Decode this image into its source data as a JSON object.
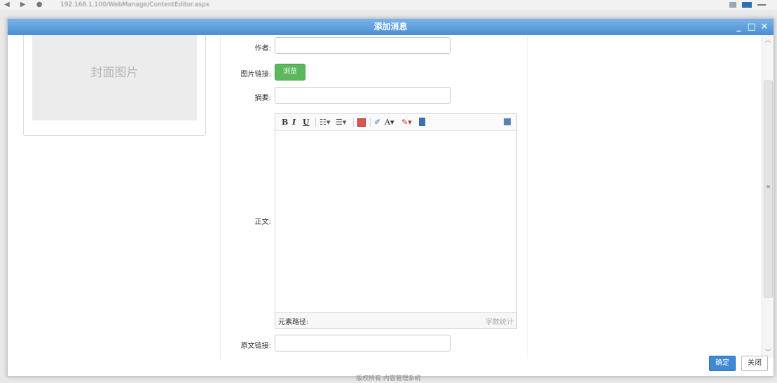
{
  "browser": {
    "url": "192.168.1.100/WebManage/ContentEditor.aspx"
  },
  "dialog": {
    "title": "添加消息",
    "controls": {
      "minimize": "_",
      "maximize": "□",
      "close": "✕"
    }
  },
  "cover": {
    "placeholder": "封面图片"
  },
  "form": {
    "author_label": "作者:",
    "image_link_label": "图片链接:",
    "browse_label": "浏览",
    "summary_label": "摘要:",
    "body_label": "正文:",
    "source_link_label": "原文链接:"
  },
  "editor": {
    "toolbar": {
      "bold": "B",
      "italic": "I",
      "underline": "U",
      "ordered_list": "☷▾",
      "unordered_list": "☰▾",
      "font_color": "A▾",
      "highlight": "✎▾"
    },
    "element_path_label": "元素路径:",
    "word_count_label": "字数统计"
  },
  "footer": {
    "ok_label": "确定",
    "close_label": "关闭"
  },
  "page_bottom_text": "版权所有 内容管理系统"
}
